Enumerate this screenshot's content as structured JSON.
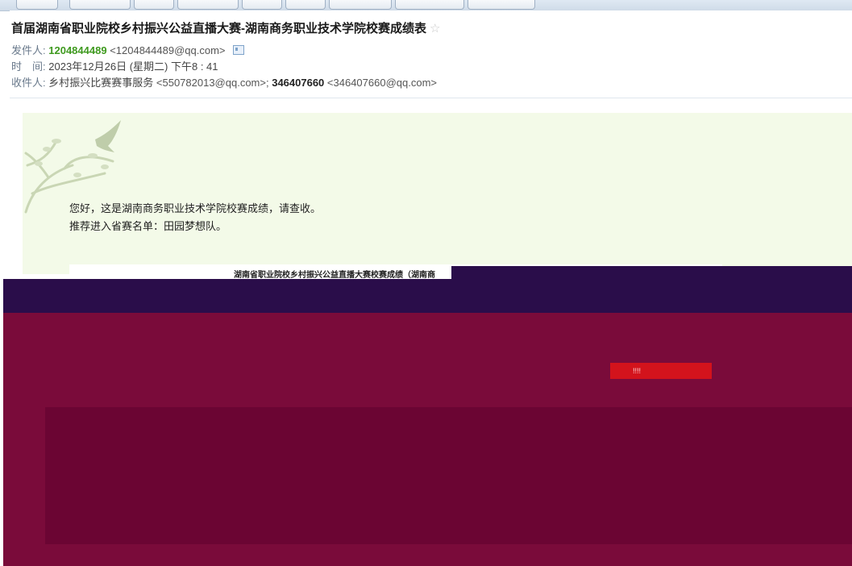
{
  "email": {
    "subject": "首届湖南省职业院校乡村振兴公益直播大赛-湖南商务职业技术学院校赛成绩表",
    "from_label": "发件人:",
    "from_name": "1204844489",
    "from_addr": "<1204844489@qq.com>",
    "time_label": "时　间:",
    "time_value": "2023年12月26日 (星期二) 下午8 : 41",
    "to_label": "收件人:",
    "to_1_name": "乡村振兴比赛赛事服务",
    "to_1_addr": "<550782013@qq.com>;",
    "to_2_name": "346407660",
    "to_2_addr": "<346407660@qq.com>"
  },
  "body": {
    "greeting": "您好，这是湖南商务职业技术学院校赛成绩，请查收。",
    "recommend": "推荐进入省赛名单：田园梦想队。",
    "table_title": "湖南省职业院校乡村振兴公益直播大赛校赛成绩（湖南商"
  },
  "button": {
    "label": "!!!!"
  },
  "icons": {
    "star": "star-icon",
    "contact": "contact-card-icon",
    "decoration": "bird-branch-icon"
  },
  "colors": {
    "sender_name": "#3f9a1f",
    "body_bg": "#f3fae8",
    "overlay_dark": "#2a0d4a",
    "overlay_red": "#7a0b3a"
  }
}
